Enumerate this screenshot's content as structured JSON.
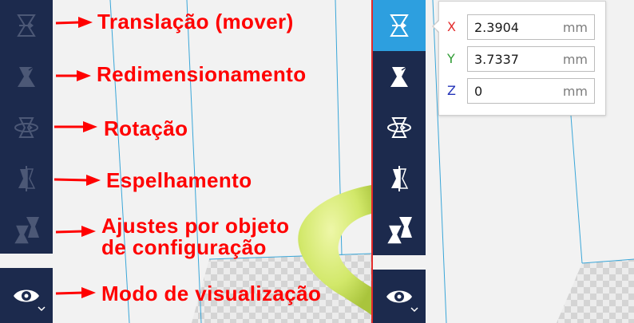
{
  "left_annotations": [
    {
      "text": "Translação (mover)"
    },
    {
      "text": "Redimensionamento"
    },
    {
      "text": "Rotação"
    },
    {
      "text": "Espelhamento"
    },
    {
      "text": "Ajustes por objeto",
      "text2": "de configuração"
    },
    {
      "text": "Modo de visualização"
    }
  ],
  "left_tools": [
    {
      "name": "translate",
      "icon": "translate-icon"
    },
    {
      "name": "scale",
      "icon": "scale-icon"
    },
    {
      "name": "rotate",
      "icon": "rotate-icon"
    },
    {
      "name": "mirror",
      "icon": "mirror-icon"
    },
    {
      "name": "per-model-settings",
      "icon": "per-model-settings-icon"
    }
  ],
  "right_tools": [
    {
      "name": "translate",
      "icon": "translate-icon",
      "active": true
    },
    {
      "name": "scale",
      "icon": "scale-icon"
    },
    {
      "name": "rotate",
      "icon": "rotate-icon"
    },
    {
      "name": "mirror",
      "icon": "mirror-icon"
    },
    {
      "name": "per-model-settings",
      "icon": "per-model-settings-icon"
    }
  ],
  "view_mode": {
    "icon": "eye-icon",
    "dropdown_icon": "chevron-down-icon"
  },
  "translate_popup": {
    "unit": "mm",
    "x": {
      "label": "X",
      "value": "2.3904",
      "color": "#e32b2b"
    },
    "y": {
      "label": "Y",
      "value": "3.7337",
      "color": "#2e9b33"
    },
    "z": {
      "label": "Z",
      "value": "0",
      "color": "#2333b8"
    }
  },
  "colors": {
    "toolbar": "#1c2a4d",
    "active_tool": "#2d9fdf",
    "annotation": "#ff0000",
    "divider": "#e32b2b",
    "model": "#d8ec73"
  }
}
